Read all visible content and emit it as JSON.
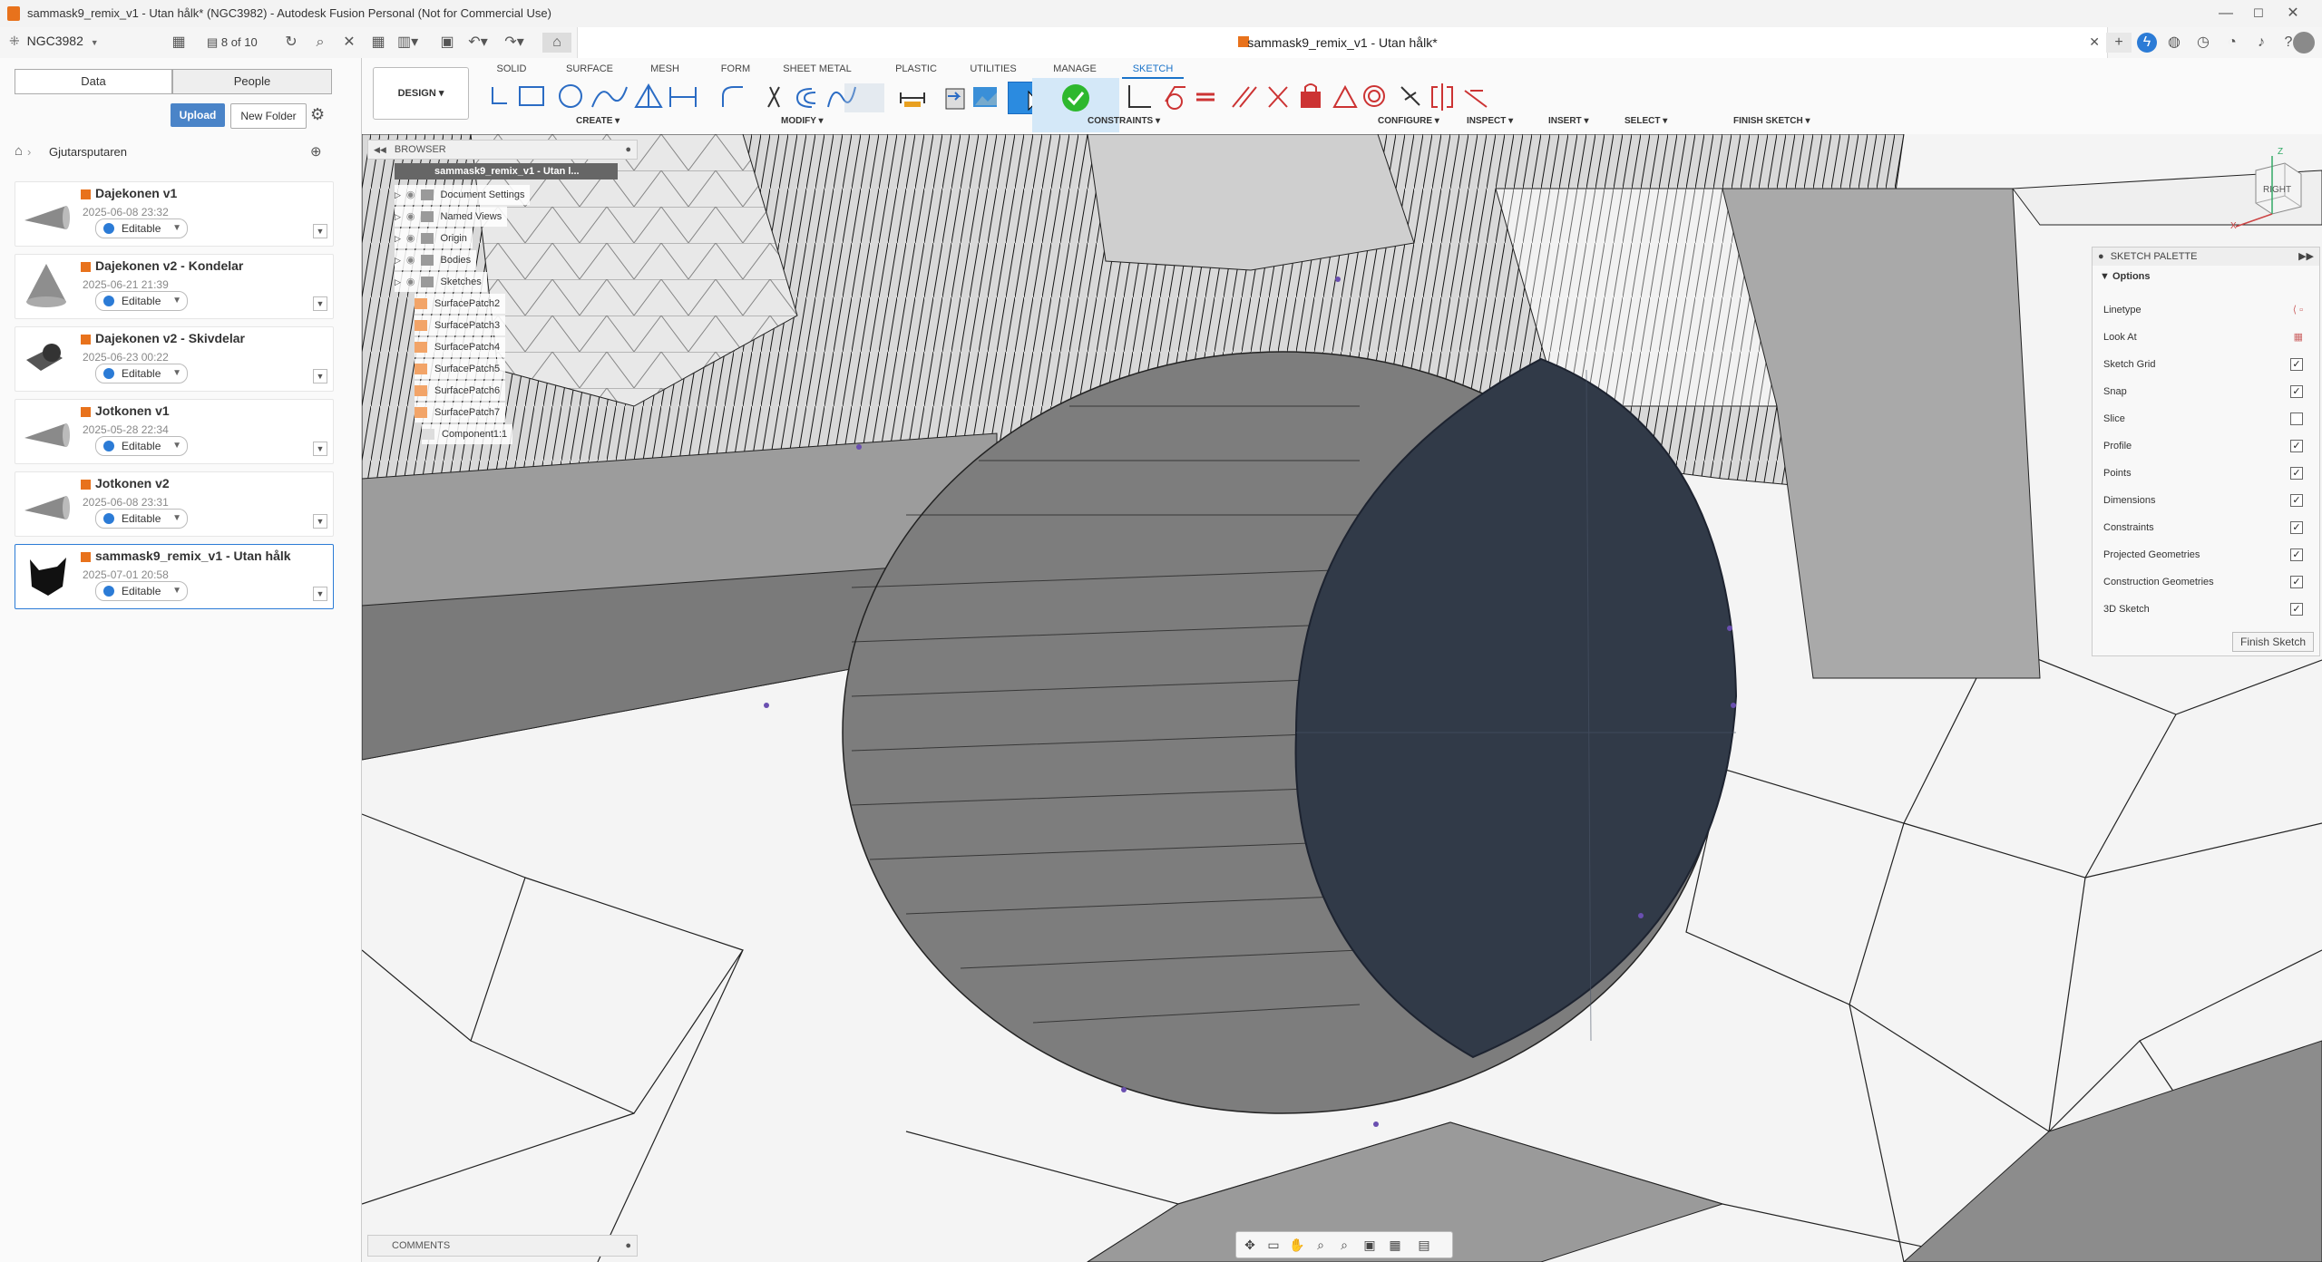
{
  "window": {
    "title": "sammask9_remix_v1 - Utan hålk* (NGC3982) - Autodesk Fusion Personal (Not for Commercial Use)"
  },
  "appbar": {
    "hub": "NGC3982",
    "job_count": "8 of 10"
  },
  "document_tab": {
    "title": "sammask9_remix_v1 - Utan hålk*"
  },
  "data_panel": {
    "tabs": [
      "Data",
      "People"
    ],
    "upload": "Upload",
    "new_folder": "New Folder",
    "project": "Gjutarsputaren",
    "files": [
      {
        "name": "Dajekonen v1",
        "date": "2025-06-08 23:32",
        "status": "Editable"
      },
      {
        "name": "Dajekonen v2 - Kondelar",
        "date": "2025-06-21 21:39",
        "status": "Editable"
      },
      {
        "name": "Dajekonen v2 - Skivdelar",
        "date": "2025-06-23 00:22",
        "status": "Editable"
      },
      {
        "name": "Jotkonen v1",
        "date": "2025-05-28 22:34",
        "status": "Editable"
      },
      {
        "name": "Jotkonen v2",
        "date": "2025-06-08 23:31",
        "status": "Editable"
      },
      {
        "name": "sammask9_remix_v1 - Utan hålk",
        "date": "2025-07-01 20:58",
        "status": "Editable"
      }
    ]
  },
  "toolbar": {
    "workspace": "DESIGN",
    "tabs": [
      "SOLID",
      "SURFACE",
      "MESH",
      "FORM",
      "SHEET METAL",
      "PLASTIC",
      "UTILITIES",
      "MANAGE",
      "SKETCH"
    ],
    "groups": {
      "create": "CREATE",
      "modify": "MODIFY",
      "constraints": "CONSTRAINTS",
      "configure": "CONFIGURE",
      "inspect": "INSPECT",
      "insert": "INSERT",
      "select": "SELECT",
      "finish": "FINISH SKETCH"
    }
  },
  "browser": {
    "header": "BROWSER",
    "root": "sammask9_remix_v1 - Utan l...",
    "items": [
      "Document Settings",
      "Named Views",
      "Origin",
      "Bodies",
      "Sketches",
      "SurfacePatch2",
      "SurfacePatch3",
      "SurfacePatch4",
      "SurfacePatch5",
      "SurfacePatch6",
      "SurfacePatch7",
      "Component1:1"
    ]
  },
  "viewcube": {
    "face": "RIGHT",
    "axis_z": "Z",
    "axis_x": "X"
  },
  "sketch_palette": {
    "header": "SKETCH PALETTE",
    "section": "Options",
    "options": [
      {
        "label": "Linetype",
        "type": "icon"
      },
      {
        "label": "Look At",
        "type": "icon"
      },
      {
        "label": "Sketch Grid",
        "checked": "✓"
      },
      {
        "label": "Snap",
        "checked": "✓"
      },
      {
        "label": "Slice",
        "checked": ""
      },
      {
        "label": "Profile",
        "checked": "✓"
      },
      {
        "label": "Points",
        "checked": "✓"
      },
      {
        "label": "Dimensions",
        "checked": "✓"
      },
      {
        "label": "Constraints",
        "checked": "✓"
      },
      {
        "label": "Projected Geometries",
        "checked": "✓"
      },
      {
        "label": "Construction Geometries",
        "checked": "✓"
      },
      {
        "label": "3D Sketch",
        "checked": "✓"
      }
    ],
    "finish": "Finish Sketch"
  },
  "comments": {
    "label": "COMMENTS"
  },
  "colors": {
    "accent": "#1a73c9",
    "fusion_orange": "#e8721c",
    "sketch_profile": "#313a48",
    "finish_green": "#2eb82e"
  }
}
